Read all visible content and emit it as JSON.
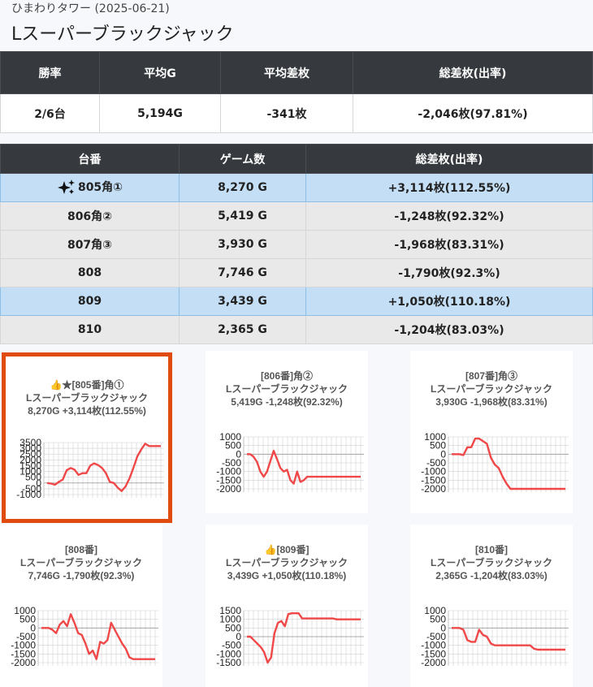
{
  "header": {
    "store_date": "ひまわりタワー (2025-06-21)",
    "title": "Lスーパーブラックジャック"
  },
  "summary": {
    "headers": [
      "勝率",
      "平均G",
      "平均差枚",
      "総差枚(出率)"
    ],
    "values": [
      "2/6台",
      "5,194G",
      "-341枚",
      "-2,046枚(97.81%)"
    ]
  },
  "machines": {
    "headers": [
      "台番",
      "ゲーム数",
      "総差枚(出率)"
    ],
    "rows": [
      {
        "id": "805角①",
        "games": "8,270 G",
        "diff": "+3,114枚(112.55%)",
        "highlight": true,
        "icon": "sparkle-icon"
      },
      {
        "id": "806角②",
        "games": "5,419 G",
        "diff": "-1,248枚(92.32%)",
        "highlight": false
      },
      {
        "id": "807角③",
        "games": "3,930 G",
        "diff": "-1,968枚(83.31%)",
        "highlight": false
      },
      {
        "id": "808",
        "games": "7,746 G",
        "diff": "-1,790枚(92.3%)",
        "highlight": false
      },
      {
        "id": "809",
        "games": "3,439 G",
        "diff": "+1,050枚(110.18%)",
        "highlight": true
      },
      {
        "id": "810",
        "games": "2,365 G",
        "diff": "-1,204枚(83.03%)",
        "highlight": false
      }
    ]
  },
  "chart_data": [
    {
      "type": "line",
      "label": "👍★[805番]角①",
      "machine": "Lスーパーブラックジャック",
      "stats": "8,270G +3,114枚(112.55%)",
      "selected": true,
      "yticks": [
        3500,
        3000,
        2500,
        2000,
        1500,
        1000,
        500,
        0,
        -500,
        -1000
      ],
      "ylim": [
        -1000,
        3500
      ],
      "color": "#f04848",
      "values": [
        0,
        -50,
        -150,
        100,
        300,
        1100,
        1300,
        1150,
        700,
        850,
        850,
        1500,
        1700,
        1550,
        1300,
        850,
        100,
        0,
        -400,
        -700,
        -300,
        400,
        1300,
        2300,
        2900,
        3400,
        3200,
        3200,
        3200,
        3200
      ]
    },
    {
      "type": "line",
      "label": "[806番]角②",
      "machine": "Lスーパーブラックジャック",
      "stats": "5,419G -1,248枚(92.32%)",
      "selected": false,
      "yticks": [
        1000,
        500,
        0,
        -500,
        -1000,
        -1500,
        -2000
      ],
      "ylim": [
        -2000,
        1000
      ],
      "color": "#f04848",
      "values": [
        0,
        0,
        -150,
        -450,
        -1000,
        -1300,
        -1000,
        -400,
        200,
        -300,
        -800,
        -1000,
        -900,
        -1500,
        -1700,
        -1000,
        -1600,
        -1500,
        -1300,
        -1300,
        -1300,
        -1300,
        -1300,
        -1300,
        -1300,
        -1300,
        -1300,
        -1300,
        -1300,
        -1300,
        -1300,
        -1300,
        -1300,
        -1300,
        -1300
      ]
    },
    {
      "type": "line",
      "label": "[807番]角③",
      "machine": "Lスーパーブラックジャック",
      "stats": "3,930G -1,968枚(83.31%)",
      "selected": false,
      "yticks": [
        1000,
        500,
        0,
        -500,
        -1000,
        -1500,
        -2000
      ],
      "ylim": [
        -2000,
        1000
      ],
      "color": "#f04848",
      "values": [
        0,
        0,
        0,
        -50,
        400,
        400,
        900,
        900,
        750,
        600,
        -200,
        -600,
        -800,
        -1300,
        -1700,
        -2000,
        -2000,
        -2000,
        -2000,
        -2000,
        -2000,
        -2000,
        -2000,
        -2000,
        -2000,
        -2000,
        -2000,
        -2000,
        -2000,
        -2000
      ]
    },
    {
      "type": "line",
      "label": "[808番]",
      "machine": "Lスーパーブラックジャック",
      "stats": "7,746G -1,790枚(92.3%)",
      "selected": false,
      "yticks": [
        1000,
        500,
        0,
        -500,
        -1000,
        -1500,
        -2000
      ],
      "ylim": [
        -2000,
        1000
      ],
      "color": "#f04848",
      "values": [
        0,
        0,
        0,
        -100,
        -300,
        200,
        400,
        100,
        800,
        300,
        -300,
        -400,
        -900,
        -1500,
        -1300,
        -1800,
        -800,
        -900,
        -700,
        300,
        -100,
        -500,
        -900,
        -1200,
        -1700,
        -1800,
        -1800,
        -1800,
        -1800,
        -1800,
        -1800,
        -1800
      ]
    },
    {
      "type": "line",
      "label": "👍[809番]",
      "machine": "Lスーパーブラックジャック",
      "stats": "3,439G +1,050枚(110.18%)",
      "selected": false,
      "yticks": [
        1500,
        1000,
        500,
        0,
        -500,
        -1000,
        -1500
      ],
      "ylim": [
        -1500,
        1500
      ],
      "color": "#f04848",
      "values": [
        0,
        0,
        -200,
        -400,
        -600,
        -900,
        -1500,
        -1200,
        200,
        800,
        900,
        600,
        1300,
        1350,
        1350,
        1350,
        1050,
        1050,
        1050,
        1050,
        1050,
        1050,
        1050,
        1050,
        1050,
        1050,
        1000,
        1000,
        1000,
        1000,
        1000,
        1000,
        1000,
        1000
      ]
    },
    {
      "type": "line",
      "label": "[810番]",
      "machine": "Lスーパーブラックジャック",
      "stats": "2,365G -1,204枚(83.03%)",
      "selected": false,
      "yticks": [
        1000,
        500,
        0,
        -500,
        -1000,
        -1500,
        -2000
      ],
      "ylim": [
        -2000,
        1000
      ],
      "color": "#f04848",
      "values": [
        0,
        0,
        0,
        -100,
        -700,
        -800,
        -800,
        -100,
        -400,
        -500,
        -900,
        -1000,
        -1000,
        -1000,
        -1000,
        -1000,
        -1000,
        -1000,
        -1000,
        -1000,
        -1000,
        -1200,
        -1250,
        -1250,
        -1250,
        -1250,
        -1250,
        -1250,
        -1250,
        -1250
      ]
    }
  ]
}
